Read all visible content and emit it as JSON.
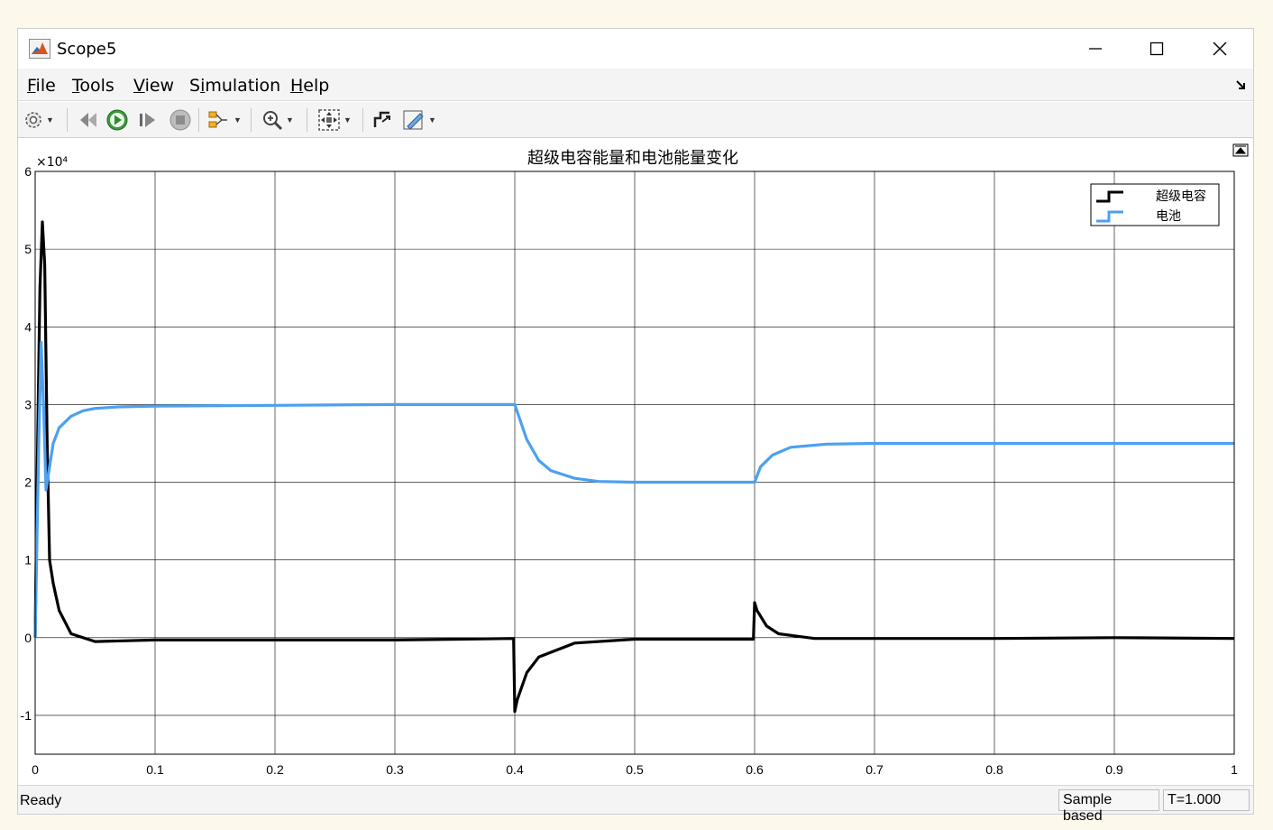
{
  "window": {
    "title": "Scope5"
  },
  "menu": [
    {
      "label": "File",
      "accel": "F",
      "rest": "ile"
    },
    {
      "label": "Tools",
      "accel": "T",
      "rest": "ools"
    },
    {
      "label": "View",
      "accel": "V",
      "rest": "iew"
    },
    {
      "label": "Simulation",
      "pre": "S",
      "accel": "i",
      "rest": "mulation"
    },
    {
      "label": "Help",
      "accel": "H",
      "rest": "elp"
    }
  ],
  "toolbar": {
    "icons": [
      "settings-icon",
      "step-back-icon",
      "run-icon",
      "step-forward-icon",
      "stop-icon",
      "signal-selector-icon",
      "zoom-in-icon",
      "autoscale-icon",
      "cursor-measure-icon",
      "style-icon"
    ]
  },
  "chart_data": {
    "type": "line",
    "title": "超级电容能量和电池能量变化",
    "y_exponent_label": "×10⁴",
    "xlim": [
      0,
      1
    ],
    "ylim": [
      -1.5,
      6
    ],
    "x_ticks": [
      "0",
      "0.1",
      "0.2",
      "0.3",
      "0.4",
      "0.5",
      "0.6",
      "0.7",
      "0.8",
      "0.9",
      "1"
    ],
    "y_ticks": [
      "-1",
      "0",
      "1",
      "2",
      "3",
      "4",
      "5",
      "6"
    ],
    "grid": true,
    "legend_placement": "top-right",
    "series": [
      {
        "name": "超级电容",
        "color": "#000000",
        "x": [
          0,
          0.002,
          0.004,
          0.006,
          0.008,
          0.01,
          0.012,
          0.015,
          0.02,
          0.03,
          0.05,
          0.1,
          0.2,
          0.3,
          0.399,
          0.4,
          0.402,
          0.41,
          0.42,
          0.45,
          0.5,
          0.599,
          0.6,
          0.602,
          0.61,
          0.62,
          0.65,
          0.7,
          0.8,
          0.9,
          1.0
        ],
        "y": [
          0,
          2.5,
          4.5,
          5.35,
          4.8,
          2.5,
          1.0,
          0.7,
          0.35,
          0.05,
          -0.05,
          -0.03,
          -0.03,
          -0.03,
          -0.01,
          -0.95,
          -0.8,
          -0.45,
          -0.25,
          -0.07,
          -0.02,
          -0.02,
          0.45,
          0.35,
          0.15,
          0.05,
          -0.01,
          -0.01,
          -0.01,
          0.0,
          -0.01
        ]
      },
      {
        "name": "电池",
        "color": "#4da0ee",
        "x": [
          0,
          0.003,
          0.005,
          0.007,
          0.009,
          0.012,
          0.015,
          0.02,
          0.03,
          0.04,
          0.05,
          0.07,
          0.1,
          0.2,
          0.3,
          0.4,
          0.41,
          0.42,
          0.43,
          0.45,
          0.47,
          0.5,
          0.55,
          0.6,
          0.605,
          0.615,
          0.63,
          0.66,
          0.7,
          0.8,
          0.9,
          1.0
        ],
        "y": [
          0,
          2.5,
          3.8,
          3.0,
          1.9,
          2.2,
          2.5,
          2.7,
          2.85,
          2.92,
          2.95,
          2.97,
          2.98,
          2.99,
          3.0,
          3.0,
          2.55,
          2.28,
          2.15,
          2.05,
          2.01,
          2.0,
          2.0,
          2.0,
          2.2,
          2.35,
          2.45,
          2.49,
          2.5,
          2.5,
          2.5,
          2.5
        ]
      }
    ]
  },
  "status": {
    "ready": "Ready",
    "sample_mode": "Sample based",
    "time": "T=1.000"
  }
}
